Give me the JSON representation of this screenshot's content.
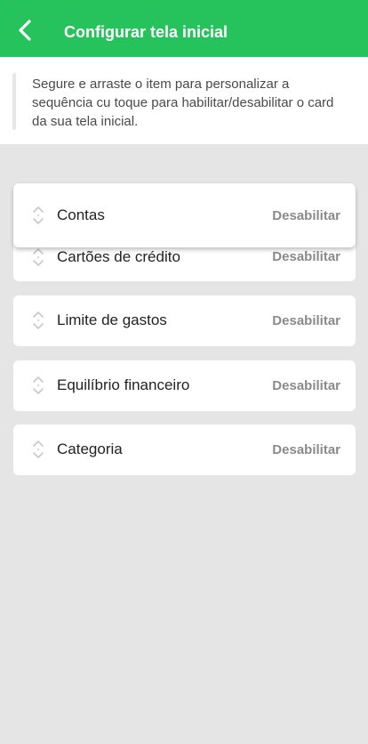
{
  "header": {
    "title": "Configurar tela inicial",
    "back_icon": "chevron-left-icon",
    "color": "#26c35d"
  },
  "info": {
    "text": "Segure e arraste o item para personalizar a sequência cu toque para habilitar/desabilitar o card da sua tela inicial."
  },
  "cards": [
    {
      "label": "Contas",
      "action": "Desabilitar",
      "state": "dragging"
    },
    {
      "label": "Cartões de crédito",
      "action": "Desabilitar"
    },
    {
      "label": "Limite de gastos",
      "action": "Desabilitar"
    },
    {
      "label": "Equilíbrio financeiro",
      "action": "Desabilitar"
    },
    {
      "label": "Categoria",
      "action": "Desabilitar"
    }
  ]
}
